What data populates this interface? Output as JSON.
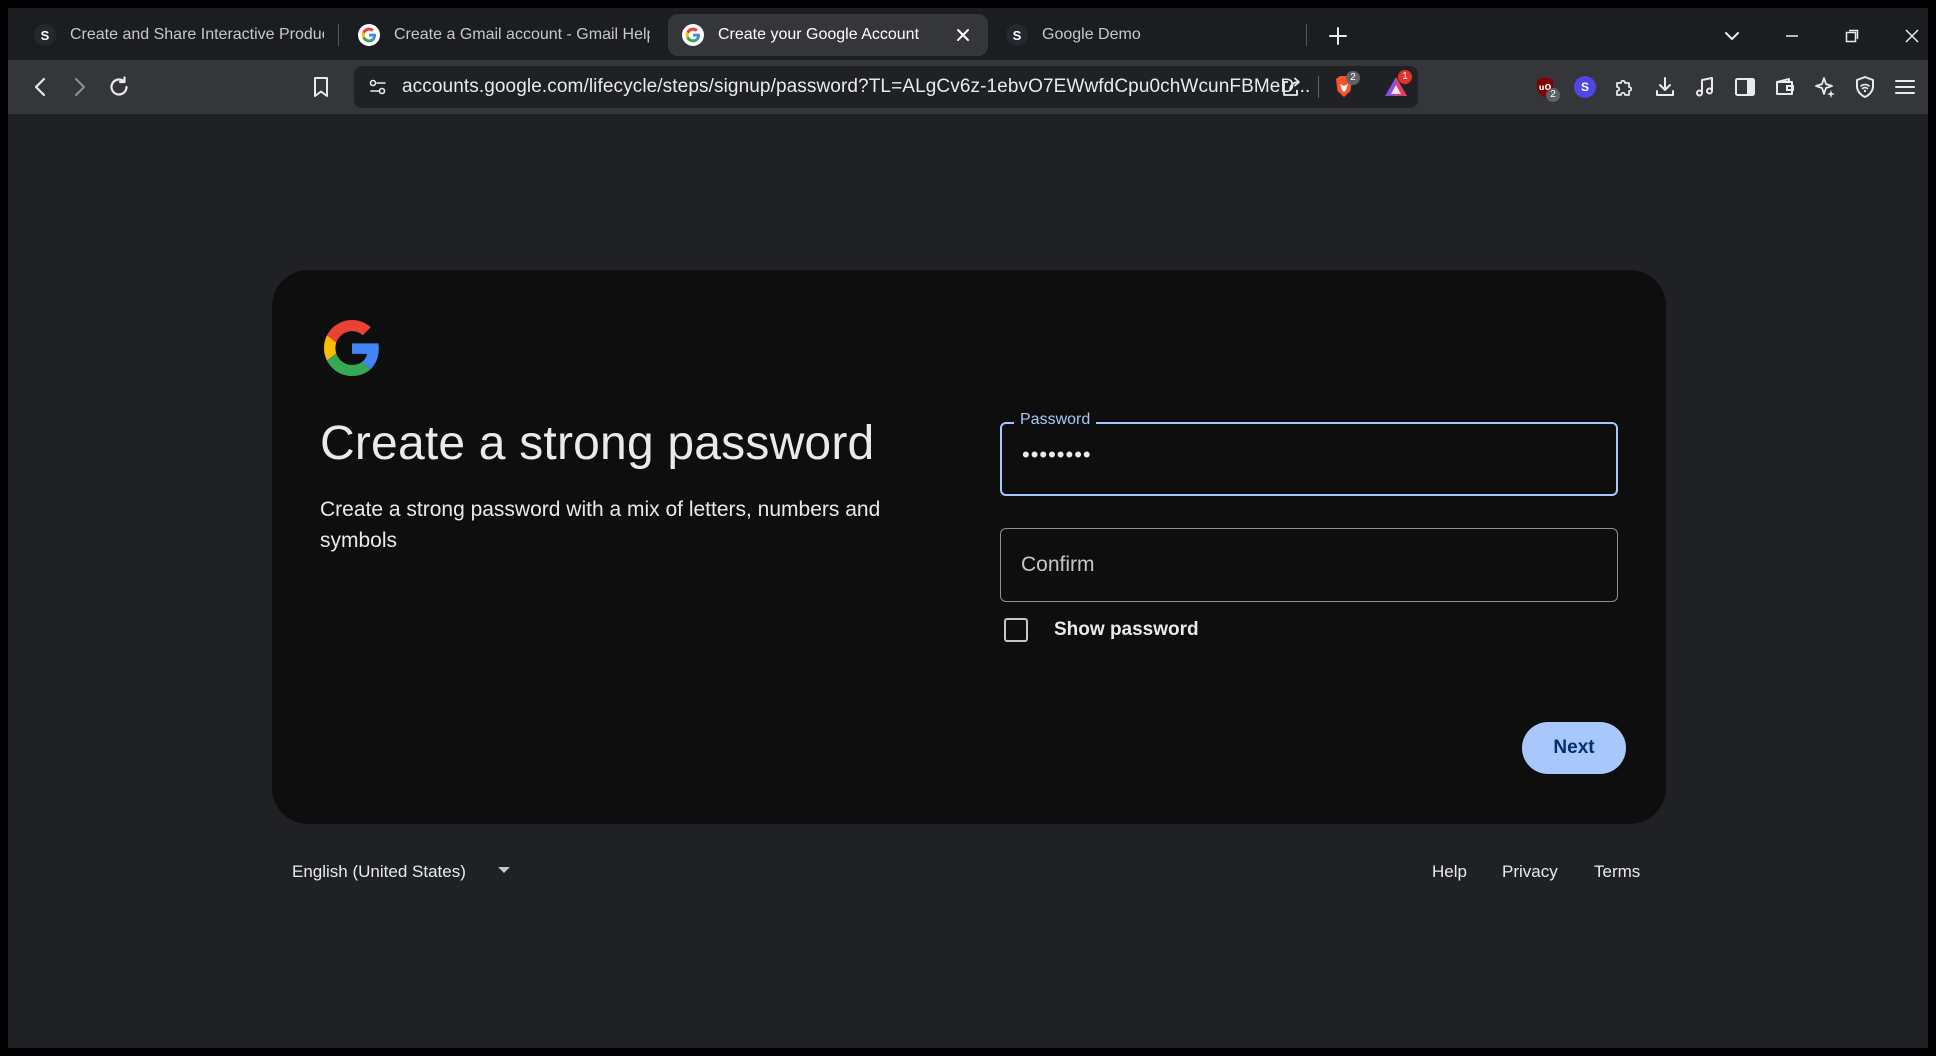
{
  "tabs": [
    {
      "title": "Create and Share Interactive Product Demos",
      "favicon": "storylane-s-icon"
    },
    {
      "title": "Create a Gmail account - Gmail Help",
      "favicon": "google-g-icon"
    },
    {
      "title": "Create your Google Account",
      "favicon": "google-g-icon",
      "active": true
    },
    {
      "title": "Google Demo",
      "favicon": "storylane-s-icon"
    }
  ],
  "toolbar": {
    "url": "accounts.google.com/lifecycle/steps/signup/password?TL=ALgCv6z-1ebvO7EWwfdCpu0chWcunFBMeD...",
    "brave_shield_badge": "2",
    "rewards_badge": "1",
    "ublock_badge": "2",
    "extension_s_letter": "S"
  },
  "card": {
    "heading": "Create a strong password",
    "subtext": "Create a strong password with a mix of letters, numbers and symbols",
    "password_label": "Password",
    "password_value": "••••••••",
    "confirm_placeholder": "Confirm",
    "show_password_label": "Show password",
    "next_label": "Next"
  },
  "footer": {
    "language": "English (United States)",
    "links": [
      "Help",
      "Privacy",
      "Terms"
    ]
  },
  "colors": {
    "page_bg": "#202124",
    "card_bg": "#0e0e0e",
    "accent": "#a8c7fa",
    "next_text": "#062e6f"
  }
}
